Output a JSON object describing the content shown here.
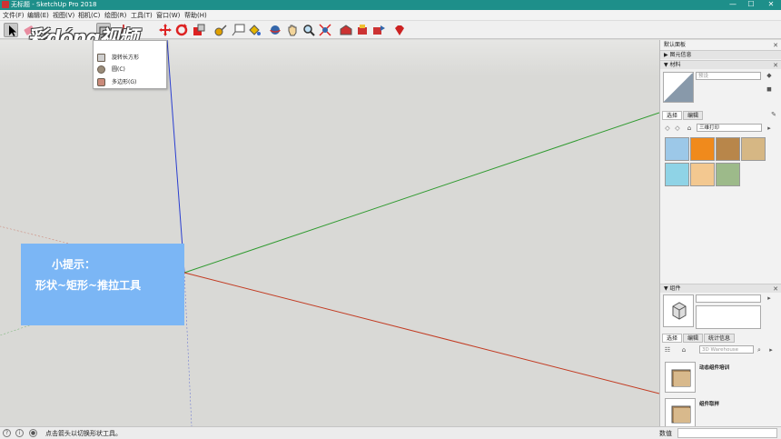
{
  "window": {
    "title": "无标题 - SketchUp Pro 2018",
    "minimize": "—",
    "maximize": "☐",
    "close": "✕"
  },
  "menu": [
    "文件(F)",
    "编辑(E)",
    "视图(V)",
    "相机(C)",
    "绘图(R)",
    "工具(T)",
    "窗口(W)",
    "帮助(H)"
  ],
  "watermark": "彩dóng视频",
  "dropdown": {
    "items": [
      "旋转长方形",
      "圆(C)",
      "多边形(G)"
    ]
  },
  "tip": {
    "title": "小提示：",
    "body": "形状~矩形~推拉工具"
  },
  "tray": {
    "title": "默认面板",
    "entity_info": "图元信息",
    "materials": {
      "header": "材料",
      "name_placeholder": "预设",
      "tabs": [
        "选择",
        "编辑"
      ],
      "library": "三维打印",
      "swatch_colors": [
        "#9cc8e8",
        "#f08a1c",
        "#b8864a",
        "#d6b784",
        "#8fd3e6",
        "#f3c890",
        "#9dba8a"
      ]
    },
    "components": {
      "header": "组件",
      "tabs": [
        "选择",
        "编辑",
        "统计信息"
      ],
      "search_placeholder": "3D Warehouse",
      "items": [
        "动态组件培训",
        "组件取样"
      ]
    }
  },
  "status": {
    "message": "点击箭头以切换形状工具。",
    "vcb_label": "数值"
  }
}
